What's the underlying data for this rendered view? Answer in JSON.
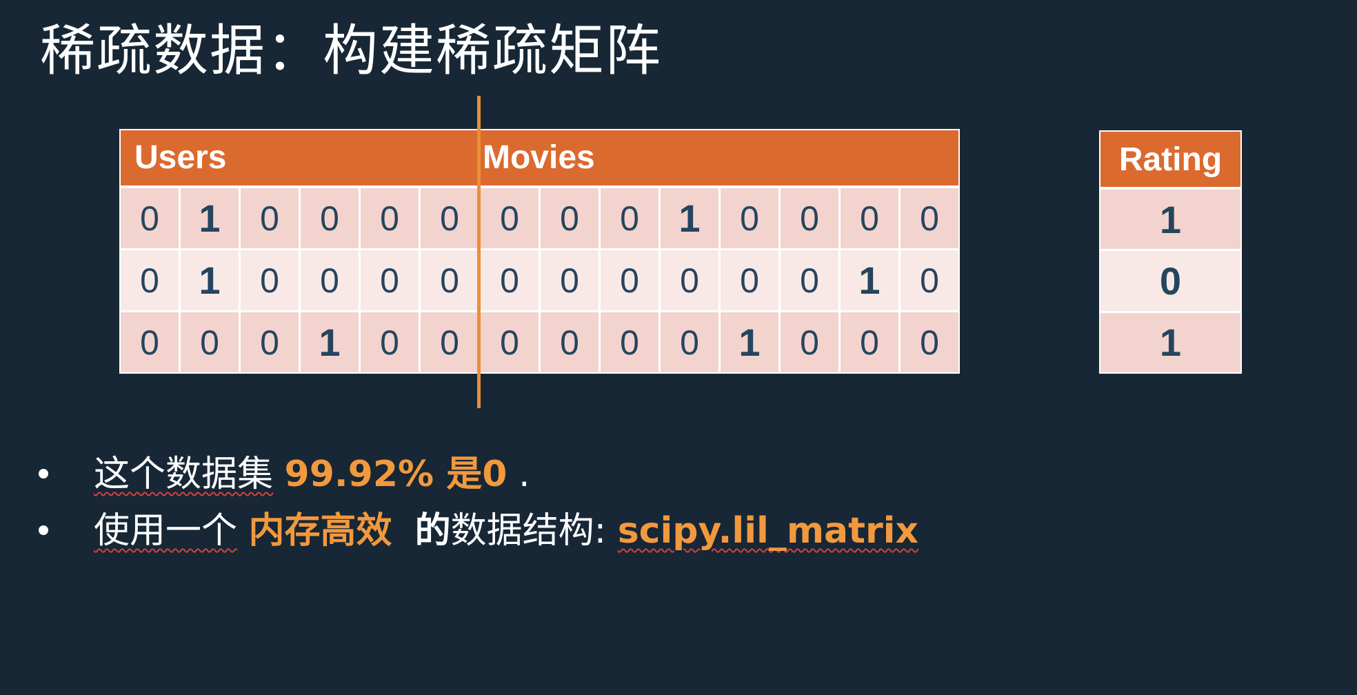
{
  "title": "稀疏数据：构建稀疏矩阵",
  "table": {
    "users_label": "Users",
    "movies_label": "Movies",
    "rows": [
      [
        "0",
        "1",
        "0",
        "0",
        "0",
        "0",
        "0",
        "0",
        "0",
        "1",
        "0",
        "0",
        "0",
        "0"
      ],
      [
        "0",
        "1",
        "0",
        "0",
        "0",
        "0",
        "0",
        "0",
        "0",
        "0",
        "0",
        "0",
        "1",
        "0"
      ],
      [
        "0",
        "0",
        "0",
        "1",
        "0",
        "0",
        "0",
        "0",
        "0",
        "0",
        "1",
        "0",
        "0",
        "0"
      ]
    ]
  },
  "rating": {
    "label": "Rating",
    "values": [
      "1",
      "0",
      "1"
    ]
  },
  "bullets": {
    "first": {
      "prefix": "这个数据集",
      "highlight": "99.92% 是0",
      "suffix": " ."
    },
    "second": {
      "prefix": "使用一个",
      "highlight": "内存高效",
      "bold": "的",
      "middle": "数据结构:",
      "code": "scipy.lil_matrix"
    }
  },
  "colors": {
    "background": "#172735",
    "header": "#DB6A2F",
    "row_dark": "#F2D3CE",
    "row_light": "#F8E9E6",
    "accent": "#F2993E",
    "cell_text": "#25445F",
    "divider": "#E98F3B"
  }
}
